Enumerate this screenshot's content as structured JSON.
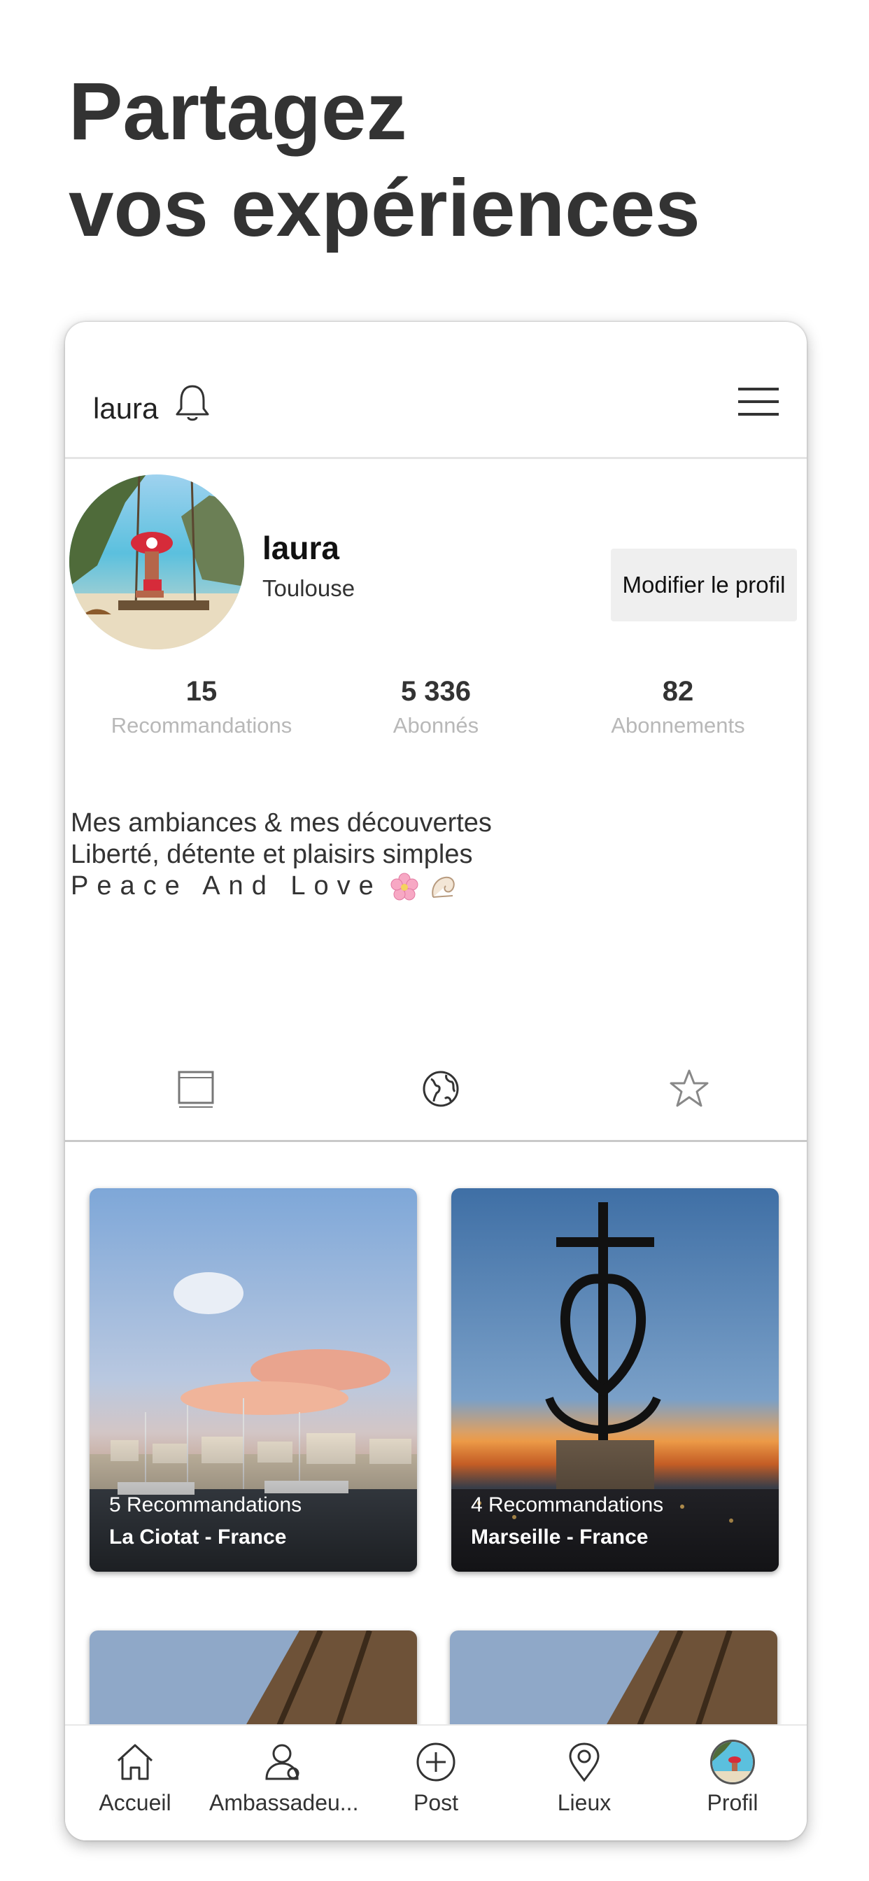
{
  "headline": {
    "line1": "Partagez",
    "line2": "vos expériences"
  },
  "topbar": {
    "username": "laura",
    "bell_icon": "bell-icon",
    "menu_icon": "hamburger-menu-icon"
  },
  "profile": {
    "name": "laura",
    "city": "Toulouse",
    "edit_button": "Modifier le profil",
    "stats": [
      {
        "value": "15",
        "label": "Recommandations"
      },
      {
        "value": "5 336",
        "label": "Abonnés"
      },
      {
        "value": "82",
        "label": "Abonnements"
      }
    ],
    "bio": {
      "line1": "Mes ambiances & mes découvertes",
      "line2": "Liberté, détente et plaisirs simples",
      "line3": "Peace And Love"
    }
  },
  "tabs": [
    {
      "icon": "grid-square-icon"
    },
    {
      "icon": "globe-icon"
    },
    {
      "icon": "star-icon"
    }
  ],
  "places": [
    {
      "count": "5 Recommandations",
      "name": "La Ciotat - France"
    },
    {
      "count": "4 Recommandations",
      "name": "Marseille - France"
    }
  ],
  "bottom_nav": [
    {
      "label": "Accueil",
      "icon": "home-icon"
    },
    {
      "label": "Ambassadeu...",
      "icon": "user-icon"
    },
    {
      "label": "Post",
      "icon": "plus-circle-icon"
    },
    {
      "label": "Lieux",
      "icon": "location-pin-icon"
    },
    {
      "label": "Profil",
      "icon": "profile-avatar"
    }
  ]
}
